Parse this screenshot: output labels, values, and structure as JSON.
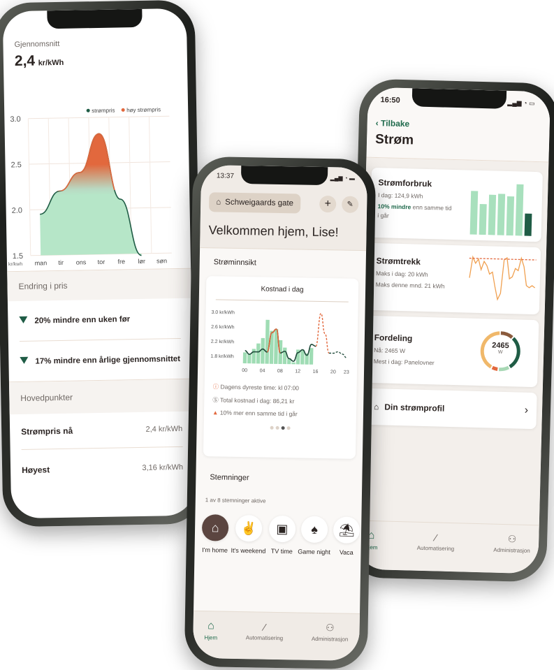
{
  "left_phone": {
    "avg_label": "Gjennomsnitt",
    "avg_value": "2,4",
    "avg_unit": "kr/kWh",
    "chart_data": {
      "type": "area",
      "legend": [
        {
          "name": "strømpris",
          "color": "#1f5c45"
        },
        {
          "name": "høy strømpris",
          "color": "#e2683d"
        }
      ],
      "legend_position": "top-right",
      "categories": [
        "man",
        "tir",
        "ons",
        "tor",
        "fre",
        "lør",
        "søn"
      ],
      "values": [
        1.95,
        2.2,
        2.4,
        2.82,
        2.1,
        1.48,
        null
      ],
      "y_ticks": [
        "3.0",
        "2.5",
        "2.0",
        "1.5"
      ],
      "ylim": [
        1.5,
        3.0
      ],
      "ylabel": "kr/kwh",
      "grid": true
    },
    "change_title": "Endring i pris",
    "changes": [
      "20% mindre enn uken før",
      "17% mindre enn årlige gjennomsnittet"
    ],
    "highlights_title": "Hovedpunkter",
    "highlights": [
      {
        "label": "Strømpris nå",
        "value": "2,4 kr/kWh"
      },
      {
        "label": "Høyest",
        "value": "3,16 kr/kWh"
      }
    ]
  },
  "middle_phone": {
    "time": "13:37",
    "address": "Schweigaards gate",
    "welcome": "Velkommen hjem, Lise!",
    "insight_title": "Strøminnsikt",
    "card_title": "Kostnad i dag",
    "chart_data": {
      "type": "bar+line",
      "y_ticks": [
        "3.0 kr/kWh",
        "2.6 kr/kWh",
        "2.2 kr/kWh",
        "1.8 kr/kWh"
      ],
      "ylim": [
        1.6,
        3.05
      ],
      "x_ticks": [
        "00",
        "04",
        "08",
        "12",
        "16",
        "20",
        "23"
      ],
      "bars": [
        1.9,
        1.85,
        2.0,
        2.15,
        2.3,
        2.8,
        2.5,
        2.55,
        2.25,
        2.05,
        1.75,
        1.65,
        2.0,
        2.0,
        1.9,
        2.05
      ],
      "price": [
        1.95,
        1.85,
        1.92,
        1.92,
        2.0,
        1.92,
        2.45,
        2.55,
        1.9,
        1.95,
        1.75,
        1.68,
        1.92,
        2.0,
        1.85,
        2.15,
        2.1,
        3.0,
        2.45,
        1.92,
        1.92,
        1.96,
        1.9,
        1.8
      ],
      "forecast_from_hour": 16,
      "high_threshold": 2.3
    },
    "facts": [
      {
        "icon": "alert-icon",
        "text": "Dagens dyreste time: kl 07:00"
      },
      {
        "icon": "currency-icon",
        "text": "Total kostnad i dag: 86,21 kr"
      },
      {
        "icon": "triangle-up-icon",
        "text": "10% mer enn samme tid i går"
      }
    ],
    "pager": {
      "count": 4,
      "active": 2
    },
    "moods_title": "Stemninger",
    "moods_status": "1 av 8 stemninger aktive",
    "moods": [
      {
        "label": "I'm home",
        "icon": "home-person-icon",
        "active": true
      },
      {
        "label": "It's weekend",
        "icon": "rock-hand-icon"
      },
      {
        "label": "TV time",
        "icon": "tv-icon"
      },
      {
        "label": "Game night",
        "icon": "cards-icon"
      },
      {
        "label": "Vaca",
        "icon": "beach-icon"
      }
    ],
    "tabs": [
      {
        "label": "Hjem",
        "active": true
      },
      {
        "label": "Automatisering"
      },
      {
        "label": "Administrasjon"
      }
    ]
  },
  "right_phone": {
    "time": "16:50",
    "back": "Tilbake",
    "title": "Strøm",
    "usage": {
      "title": "Strømforbruk",
      "today": "I dag: 124,9 kWh",
      "highlight": "10% mindre",
      "rest": "enn samme tid i går",
      "bars": [
        0.78,
        0.55,
        0.72,
        0.74,
        0.7,
        0.92,
        0.4
      ]
    },
    "draw": {
      "title": "Strømtrekk",
      "max_today": "Maks i dag: 20 kWh",
      "max_month": "Maks denne mnd. 21 kWh",
      "series": [
        10,
        20,
        17,
        19,
        14,
        18,
        16,
        12,
        13,
        6,
        0,
        3,
        19,
        20,
        10,
        11,
        15,
        14,
        20,
        16,
        7,
        6,
        7,
        6
      ]
    },
    "distribution": {
      "title": "Fordeling",
      "now": "Nå: 2465 W",
      "most": "Mest i dag: Panelovner",
      "value": "2465",
      "unit": "W",
      "segments": [
        {
          "v": 0.12,
          "c": "#8a5a3c"
        },
        {
          "v": 0.3,
          "c": "#1f5c45"
        },
        {
          "v": 0.1,
          "c": "#a8d8b5"
        },
        {
          "v": 0.06,
          "c": "#e2683d"
        },
        {
          "v": 0.42,
          "c": "#f0b86a"
        }
      ]
    },
    "profile": "Din strømprofil",
    "tabs": [
      {
        "label": "Hjem",
        "active": true
      },
      {
        "label": "Automatisering"
      },
      {
        "label": "Administrasjon"
      }
    ]
  },
  "colors": {
    "green": "#1f5c45",
    "light_green": "#a8e0bd",
    "orange": "#e2683d",
    "beige": "#e8ded3"
  }
}
